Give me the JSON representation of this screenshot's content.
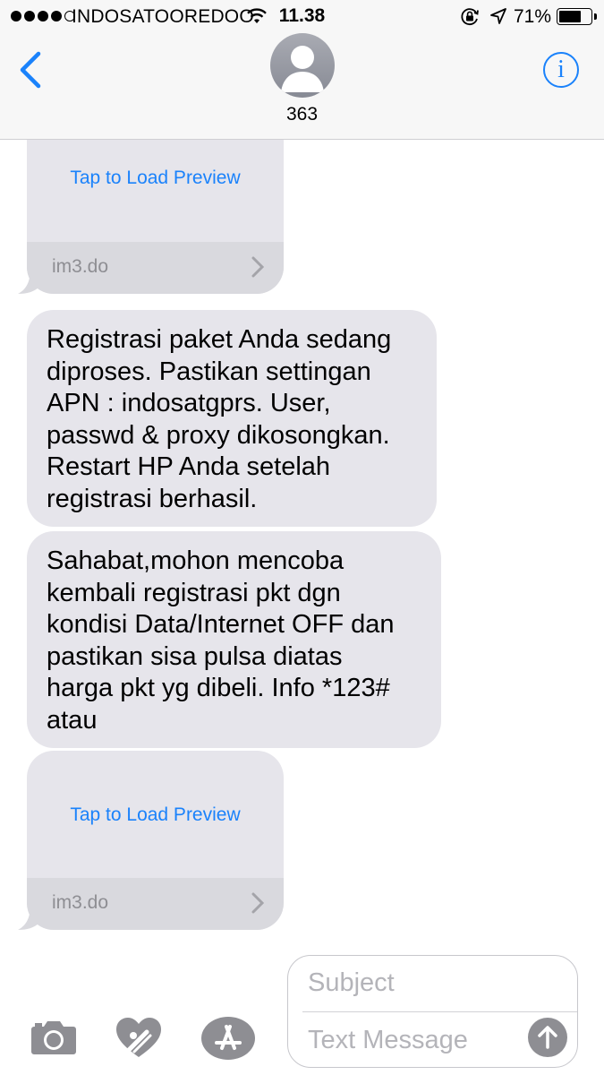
{
  "status_bar": {
    "carrier": "INDOSATOOREDOO",
    "time": "11.38",
    "battery": "71%",
    "signal_dots_filled": 4,
    "signal_dots_total": 5,
    "icons": [
      "wifi-icon",
      "orientation-lock-icon",
      "location-icon",
      "battery-icon"
    ]
  },
  "header": {
    "contact": "363",
    "back_icon": "chevron-left-icon",
    "info_icon": "info-icon"
  },
  "messages": [
    {
      "type": "link-preview",
      "tap_label": "Tap to Load Preview",
      "domain": "im3.do"
    },
    {
      "type": "text",
      "lines": [
        "Registrasi paket Anda sedang",
        "diproses. Pastikan settingan",
        "APN : indosatgprs. User,",
        "passwd & proxy dikosongkan.",
        "Restart HP Anda setelah",
        "registrasi berhasil."
      ]
    },
    {
      "type": "text",
      "lines": [
        "Sahabat,mohon mencoba",
        "kembali registrasi pkt dgn",
        "kondisi Data/Internet OFF dan",
        "pastikan sisa pulsa diatas",
        "harga pkt yg dibeli. Info *123#",
        "atau"
      ]
    },
    {
      "type": "link-preview",
      "tap_label": "Tap to Load Preview",
      "domain": "im3.do"
    }
  ],
  "compose": {
    "subject_placeholder": "Subject",
    "message_placeholder": "Text Message",
    "tools": [
      "camera-icon",
      "digital-touch-heart-icon",
      "app-store-icon"
    ],
    "send_icon": "send-arrow-up-icon"
  },
  "colors": {
    "accent": "#1a82fb",
    "bubble_gray": "#e6e5eb",
    "preview_footer": "#d9d9de",
    "header_bg": "#f7f7f7",
    "icon_gray": "#8e8e93"
  }
}
